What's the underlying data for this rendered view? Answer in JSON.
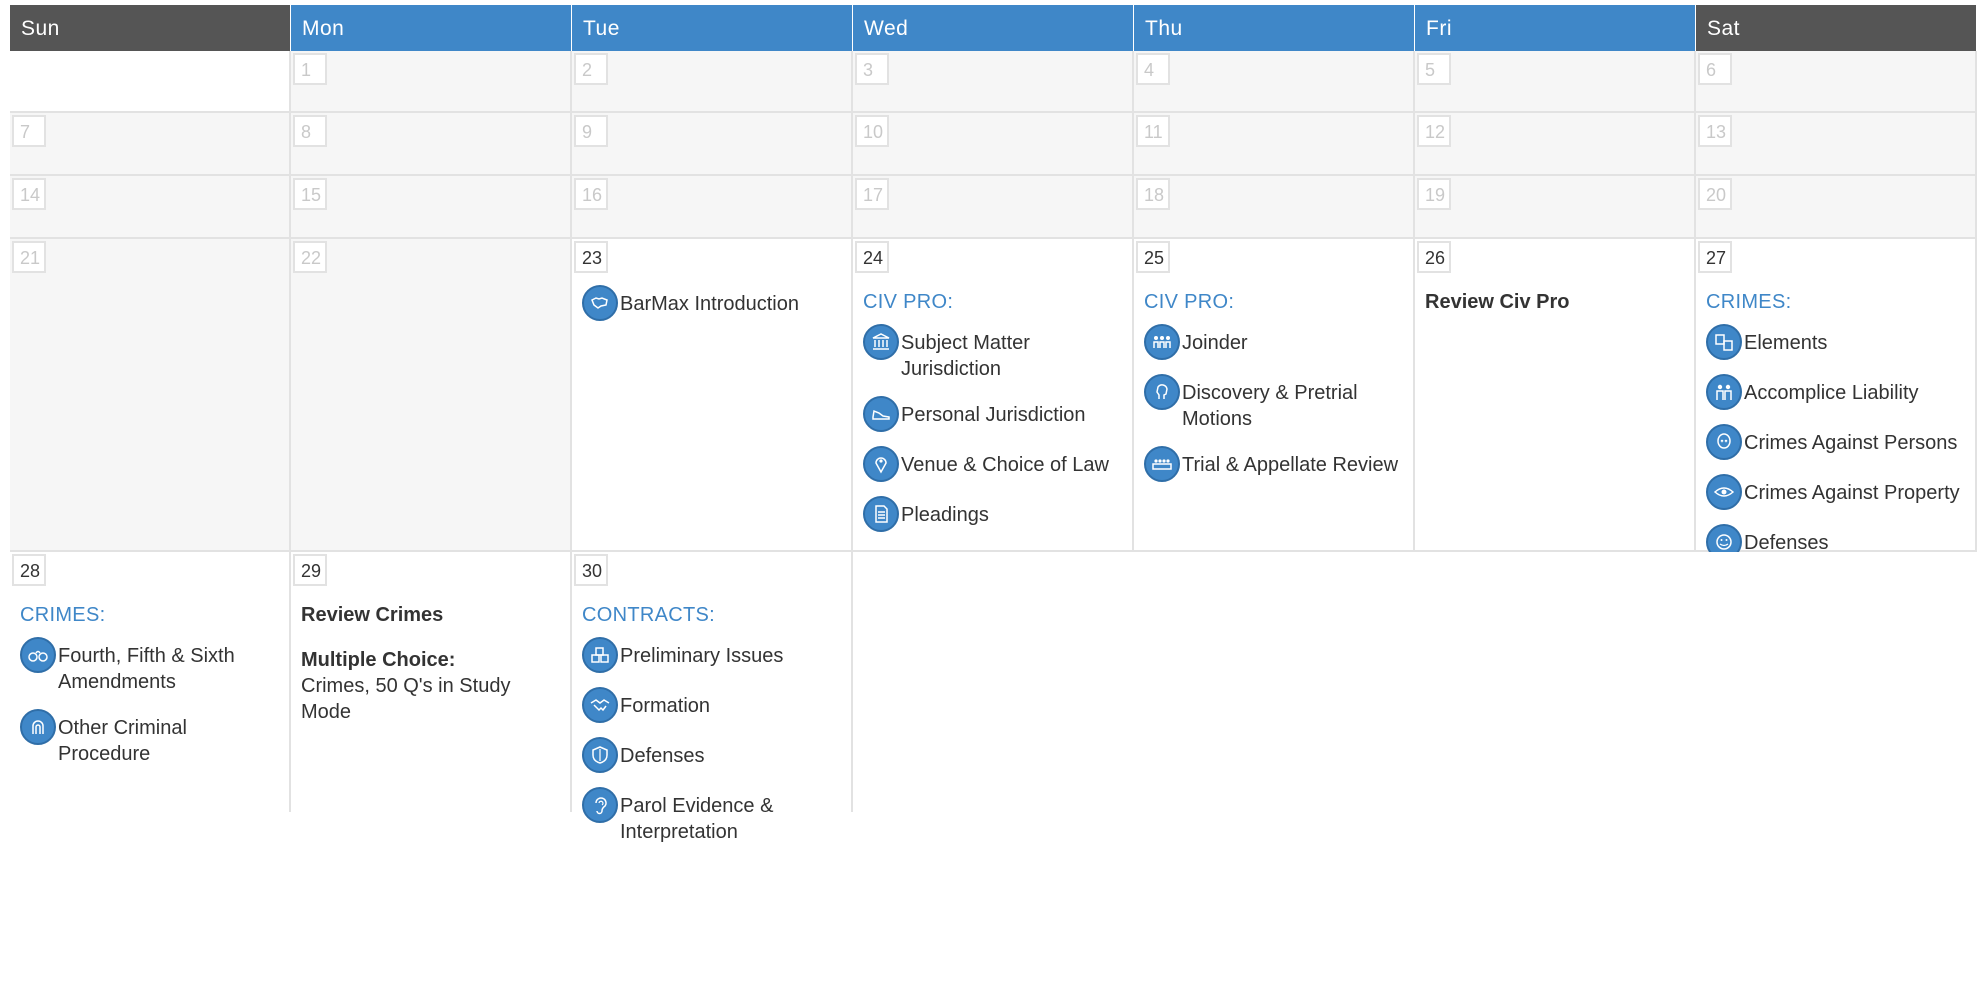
{
  "weekdays": [
    "Sun",
    "Mon",
    "Tue",
    "Wed",
    "Thu",
    "Fri",
    "Sat"
  ],
  "weeks": [
    {
      "days": [
        "",
        "1",
        "2",
        "3",
        "4",
        "5",
        "6"
      ]
    },
    {
      "days": [
        "7",
        "8",
        "9",
        "10",
        "11",
        "12",
        "13"
      ]
    },
    {
      "days": [
        "14",
        "15",
        "16",
        "17",
        "18",
        "19",
        "20"
      ]
    },
    {
      "days": [
        "21",
        "22",
        "23",
        "24",
        "25",
        "26",
        "27"
      ]
    },
    {
      "days": [
        "28",
        "29",
        "30"
      ]
    }
  ],
  "d23": {
    "items": [
      {
        "label": "BarMax Introduction",
        "icon": "map-icon"
      }
    ]
  },
  "d24": {
    "section": "CIV PRO:",
    "items": [
      {
        "label": "Subject Matter Jurisdiction",
        "icon": "courthouse-icon"
      },
      {
        "label": "Personal Jurisdiction",
        "icon": "sneaker-icon"
      },
      {
        "label": "Venue & Choice of Law",
        "icon": "location-pin-icon"
      },
      {
        "label": "Pleadings",
        "icon": "document-icon"
      }
    ]
  },
  "d25": {
    "section": "CIV PRO:",
    "items": [
      {
        "label": "Joinder",
        "icon": "group-icon"
      },
      {
        "label": "Discovery & Pretrial Motions",
        "icon": "person-profile-icon"
      },
      {
        "label": "Trial & Appellate Review",
        "icon": "jury-box-icon"
      }
    ]
  },
  "d26": {
    "title": "Review Civ Pro"
  },
  "d27": {
    "section": "CRIMES:",
    "items": [
      {
        "label": "Elements",
        "icon": "elements-icon"
      },
      {
        "label": "Accomplice Liability",
        "icon": "accomplices-icon"
      },
      {
        "label": "Crimes Against Persons",
        "icon": "victim-icon"
      },
      {
        "label": "Crimes Against Property",
        "icon": "eye-icon"
      },
      {
        "label": "Defenses",
        "icon": "face-icon"
      }
    ]
  },
  "d28": {
    "section": "CRIMES:",
    "items": [
      {
        "label": "Fourth, Fifth & Sixth Amendments",
        "icon": "handcuffs-icon"
      },
      {
        "label": "Other Criminal Procedure",
        "icon": "fingerprint-icon"
      }
    ]
  },
  "d29": {
    "title": "Review Crimes",
    "mc_bold": "Multiple Choice:",
    "mc_text": "Crimes, 50 Q's in Study Mode"
  },
  "d30": {
    "section": "CONTRACTS:",
    "items": [
      {
        "label": "Preliminary Issues",
        "icon": "blocks-icon"
      },
      {
        "label": "Formation",
        "icon": "handshake-icon"
      },
      {
        "label": "Defenses",
        "icon": "shield-icon"
      },
      {
        "label": "Parol Evidence & Interpretation",
        "icon": "ear-icon"
      }
    ]
  },
  "colors": {
    "header_grey": "#555555",
    "header_blue": "#3f87c8",
    "accent": "#3f87c8"
  }
}
